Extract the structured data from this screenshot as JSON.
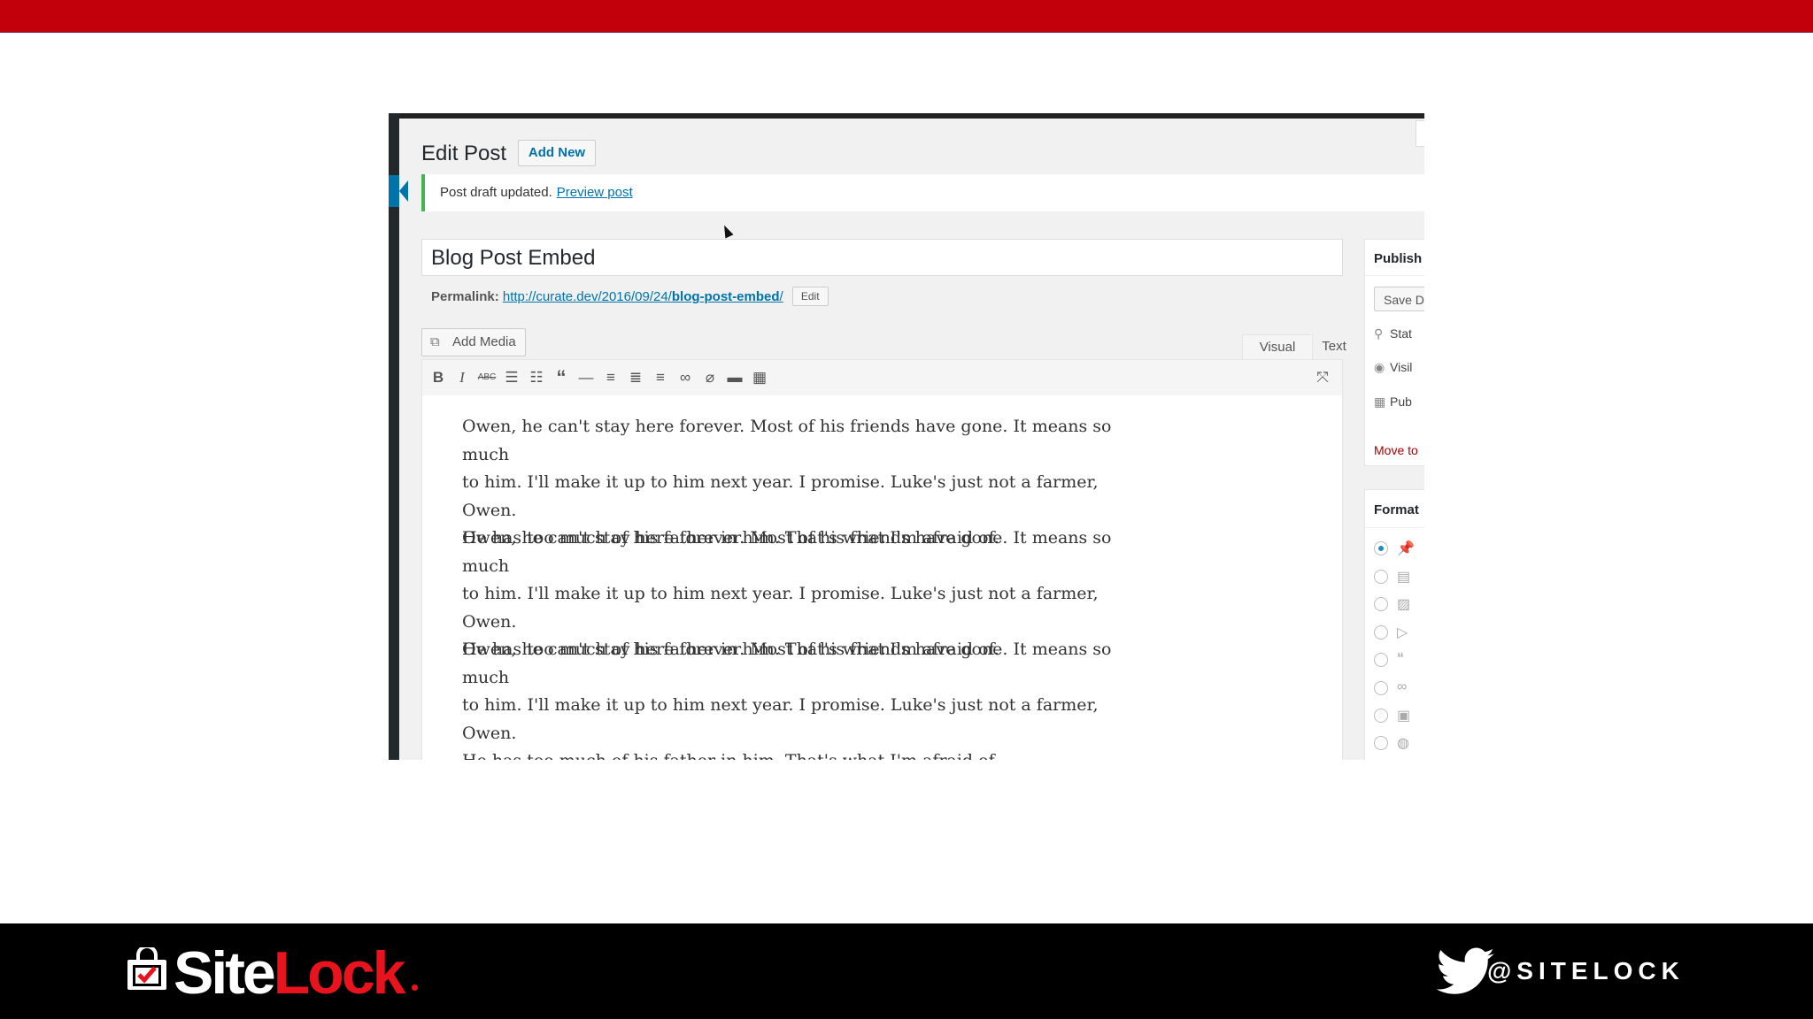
{
  "slide": {
    "top_bar_color": "#c1000b",
    "footer_color": "#000000"
  },
  "editor": {
    "page_title": "Edit Post",
    "add_new_label": "Add New",
    "notice": {
      "text": "Post draft updated.",
      "link": "Preview post"
    },
    "post_title": "Blog Post Embed",
    "permalink": {
      "label": "Permalink:",
      "url_base": "http://curate.dev/2016/09/24/",
      "url_slug": "blog-post-embed",
      "url_tail": "/",
      "edit_label": "Edit"
    },
    "add_media_label": "Add Media",
    "tabs": {
      "visual": "Visual",
      "text": "Text"
    },
    "toolbar_icons": [
      "bold-icon",
      "italic-icon",
      "strikethrough-icon",
      "bullet-list-icon",
      "numbered-list-icon",
      "blockquote-icon",
      "horizontal-rule-icon",
      "align-left-icon",
      "align-center-icon",
      "align-right-icon",
      "link-icon",
      "unlink-icon",
      "read-more-icon",
      "toolbar-toggle-icon",
      "fullscreen-icon"
    ],
    "paragraphs": [
      {
        "line1": "Owen, he can't stay here forever. Most of his friends have gone. It means so much",
        "line2": "to him. I'll make it up to him next year. I promise. Luke's just not a farmer, Owen.",
        "line3": "He has too much of his father in him. That's what I'm afraid of."
      },
      {
        "line1": "Owen, he can't stay here forever. Most of his friends have gone. It means so much",
        "line2": "to him. I'll make it up to him next year. I promise. Luke's just not a farmer, Owen.",
        "line3": "He has too much of his father in him. That's what I'm afraid of."
      },
      {
        "line1": "Owen, he can't stay here forever. Most of his friends have gone. It means so much",
        "line2": "to him. I'll make it up to him next year. I promise. Luke's just not a farmer, Owen.",
        "line3": "He has too much of his father in him. That's what I'm afraid of."
      }
    ],
    "publish_box": {
      "heading": "Publish",
      "save_label": "Save D",
      "status": "Stat",
      "visibility": "Visil",
      "publish_date": "Pub",
      "move_to_trash": "Move to"
    },
    "format_box": {
      "heading": "Format",
      "options": [
        "pin-icon",
        "aside-icon",
        "image-icon",
        "video-icon",
        "quote-icon",
        "link-icon",
        "gallery-icon",
        "chat-icon"
      ],
      "selected_index": 0
    },
    "accent_color": "#0073aa"
  },
  "footer": {
    "logo": {
      "site": "Site",
      "lock": "Lock"
    },
    "twitter_handle": "@SITELOCK",
    "logo_red": "#e8131d"
  }
}
